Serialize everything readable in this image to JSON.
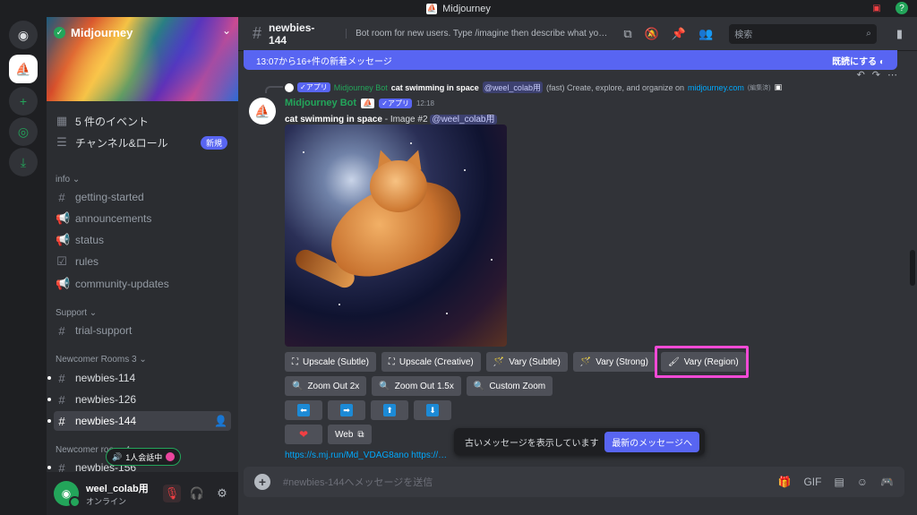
{
  "window": {
    "title": "Midjourney"
  },
  "server": {
    "name": "Midjourney"
  },
  "sidebar": {
    "top_items": [
      {
        "label": "5 件のイベント",
        "icon": "calendar-icon"
      },
      {
        "label": "チャンネル&ロール",
        "icon": "channels-roles-icon",
        "badge": "新規"
      }
    ],
    "categories": [
      {
        "label": "info ⌄",
        "channels": [
          {
            "label": "getting-started",
            "icon": "hash-icon"
          },
          {
            "label": "announcements",
            "icon": "megaphone-icon"
          },
          {
            "label": "status",
            "icon": "megaphone-icon"
          },
          {
            "label": "rules",
            "icon": "rules-icon"
          },
          {
            "label": "community-updates",
            "icon": "megaphone-icon"
          }
        ]
      },
      {
        "label": "Support ⌄",
        "channels": [
          {
            "label": "trial-support",
            "icon": "hash-icon"
          }
        ]
      },
      {
        "label": "Newcomer Rooms 3 ⌄",
        "channels": [
          {
            "label": "newbies-114",
            "icon": "hash-threads-icon"
          },
          {
            "label": "newbies-126",
            "icon": "hash-threads-icon"
          },
          {
            "label": "newbies-144",
            "icon": "hash-threads-icon",
            "selected": true
          }
        ]
      },
      {
        "label": "Newcomer roo… 4",
        "channels": [
          {
            "label": "newbies-156",
            "icon": "hash-threads-icon"
          }
        ]
      }
    ]
  },
  "voice_pill": {
    "label": "1人会話中"
  },
  "user": {
    "name": "weel_colab用",
    "status": "オンライン"
  },
  "header": {
    "channel": "newbies-144",
    "topic": "Bot room for new users. Type /imagine then describe what you want t...",
    "search_placeholder": "検索"
  },
  "new_messages_bar": {
    "text": "13:07から16+件の新着メッセージ",
    "action": "既読にする"
  },
  "reply": {
    "app_tag": "✓アプリ",
    "author": "Midjourney Bot",
    "prompt": "cat swimming in space",
    "mention": "@weel_colab用",
    "rest": "(fast) Create, explore, and organize on",
    "link": "midjourney.com",
    "edited": "(編集済)"
  },
  "message": {
    "author": "Midjourney Bot",
    "app_tag": "✓アプリ",
    "time": "12:18",
    "prompt": "cat swimming in space",
    "suffix": "- Image #2",
    "mention": "@weel_colab用"
  },
  "buttons": {
    "row1": [
      "Upscale (Subtle)",
      "Upscale (Creative)",
      "Vary (Subtle)",
      "Vary (Strong)",
      "Vary (Region)"
    ],
    "row2": [
      "Zoom Out 2x",
      "Zoom Out 1.5x",
      "Custom Zoom"
    ],
    "row3": [
      "⬅",
      "➡",
      "⬆",
      "⬇"
    ],
    "row4": [
      "❤",
      "Web"
    ]
  },
  "jump_bar": {
    "text": "古いメッセージを表示しています",
    "button": "最新のメッセージへ"
  },
  "last_link": "https://s.mj.run/Md_VDAG8ano https://…",
  "composer": {
    "placeholder": "#newbies-144へメッセージを送信"
  },
  "colors": {
    "accent": "#5865f2",
    "online": "#23a55a",
    "highlight": "#f24ad6"
  }
}
